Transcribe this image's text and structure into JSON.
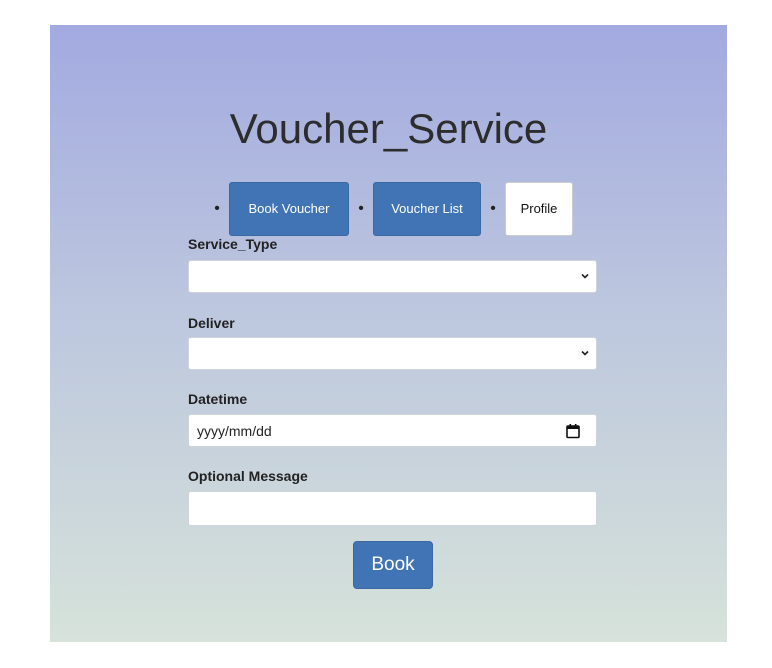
{
  "page": {
    "title": "Voucher_Service"
  },
  "nav": {
    "items": [
      {
        "label": "Book Voucher",
        "style": "primary"
      },
      {
        "label": "Voucher List",
        "style": "primary"
      },
      {
        "label": "Profile",
        "style": "plain"
      }
    ],
    "bullet": "•"
  },
  "form": {
    "service_type": {
      "label": "Service_Type",
      "value": ""
    },
    "deliver": {
      "label": "Deliver",
      "value": ""
    },
    "datetime": {
      "label": "Datetime",
      "placeholder": "yyyy/mm/dd"
    },
    "optional_message": {
      "label": "Optional Message",
      "value": ""
    },
    "submit_label": "Book"
  },
  "colors": {
    "primary_button": "#4074b4",
    "gradient_top": "#a2aae0",
    "gradient_bottom": "#d6e2da"
  },
  "icons": {
    "select": "chevron-down-icon",
    "date": "calendar-icon"
  }
}
